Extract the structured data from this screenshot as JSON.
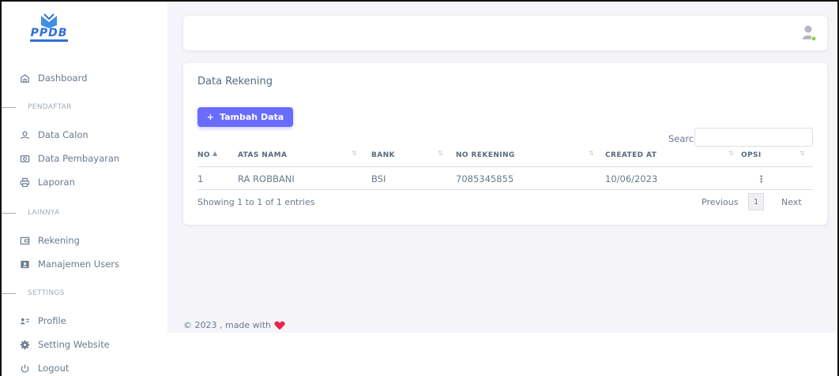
{
  "logo": {
    "text": "PPDB"
  },
  "sidebar": {
    "dashboard": "Dashboard",
    "section_pendaftar": "PENDAFTAR",
    "data_calon": "Data Calon",
    "data_pembayaran": "Data Pembayaran",
    "laporan": "Laporan",
    "section_lainnya": "LAINNYA",
    "rekening": "Rekening",
    "manajemen_users": "Manajemen Users",
    "section_settings": "SETTINGS",
    "profile": "Profile",
    "setting_website": "Setting Website",
    "logout": "Logout"
  },
  "card": {
    "title": "Data Rekening",
    "add_button": "Tambah Data",
    "add_icon": "+",
    "search_label": "Search:",
    "search_value": "",
    "columns": [
      "NO",
      "ATAS NAMA",
      "BANK",
      "NO REKENING",
      "CREATED AT",
      "OPSI"
    ],
    "rows": [
      {
        "no": "1",
        "atas_nama": "RA ROBBANI",
        "bank": "BSI",
        "no_rekening": "7085345855",
        "created_at": "10/06/2023",
        "opsi": "⋮"
      }
    ],
    "info": "Showing 1 to 1 of 1 entries",
    "pagination": {
      "previous": "Previous",
      "page": "1",
      "next": "Next"
    }
  },
  "footer": {
    "text": "© 2023 , made with"
  },
  "colors": {
    "accent": "#696cff",
    "heart": "#e8254b",
    "online": "#71dd37"
  }
}
